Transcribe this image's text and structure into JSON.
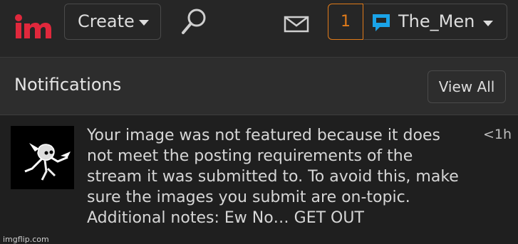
{
  "brand": {
    "logo_text": "im",
    "accent_color": "#e0283c"
  },
  "header": {
    "create_label": "Create",
    "notification_count": "1",
    "username": "The_Men",
    "username_icon_color": "#1aa3e8",
    "icons": [
      "search-icon",
      "mail-icon",
      "chevron-down-icon"
    ]
  },
  "notifications": {
    "title": "Notifications",
    "view_all_label": "View All",
    "items": [
      {
        "message": "Your image was not featured because it does not meet the posting requirements of the stream it was submitted to. To avoid this, make sure the images you submit are on-topic. Additional notes: Ew No… GET OUT",
        "time": "<1h"
      }
    ]
  },
  "watermark": "imgflip.com"
}
